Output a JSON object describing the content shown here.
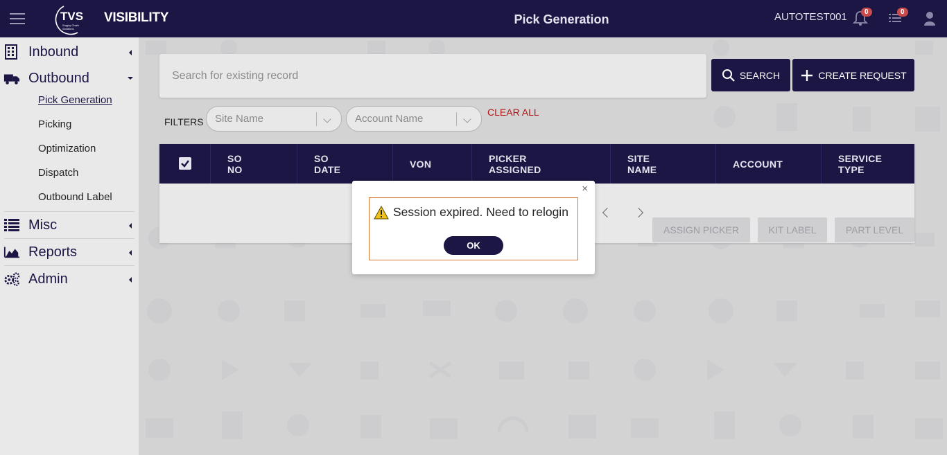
{
  "header": {
    "logo_text": "TVS",
    "logo_subtext": "Supply Chain Solutions",
    "brand": "VISIBILITY",
    "page_title": "Pick Generation",
    "username": "AUTOTEST001",
    "notifications_count": "0",
    "tasks_count": "0"
  },
  "sidebar": {
    "groups": [
      {
        "label": "Inbound",
        "icon": "building-icon"
      },
      {
        "label": "Outbound",
        "icon": "truck-icon",
        "expanded": true,
        "items": [
          "Pick Generation",
          "Picking",
          "Optimization",
          "Dispatch",
          "Outbound Label"
        ]
      },
      {
        "label": "Misc",
        "icon": "list-icon"
      },
      {
        "label": "Reports",
        "icon": "area-chart-icon"
      },
      {
        "label": "Admin",
        "icon": "gears-icon"
      }
    ]
  },
  "main": {
    "search_placeholder": "Search for existing record",
    "search_button": "SEARCH",
    "create_button": "CREATE REQUEST",
    "filters_label": "FILTERS",
    "site_placeholder": "Site Name",
    "account_placeholder": "Account Name",
    "clear_all": "CLEAR ALL",
    "table_headers": [
      "SO NO",
      "SO DATE",
      "VON",
      "PICKER ASSIGNED",
      "SITE NAME",
      "ACCOUNT",
      "SERVICE TYPE"
    ],
    "table_headers_lines": [
      [
        "SO",
        "NO"
      ],
      [
        "SO",
        "DATE"
      ],
      [
        "VON"
      ],
      [
        "PICKER",
        "ASSIGNED"
      ],
      [
        "SITE",
        "NAME"
      ],
      [
        "ACCOUNT"
      ],
      [
        "SERVICE",
        "TYPE"
      ]
    ],
    "actions": [
      "ASSIGN PICKER",
      "KIT LABEL",
      "PART LEVEL"
    ]
  },
  "modal": {
    "message": "Session expired. Need to relogin",
    "ok_label": "OK",
    "close_symbol": "×"
  },
  "colors": {
    "primary": "#1c1645",
    "danger": "#b11515",
    "badge": "#c94b4b",
    "modal_border": "#d9742f"
  }
}
